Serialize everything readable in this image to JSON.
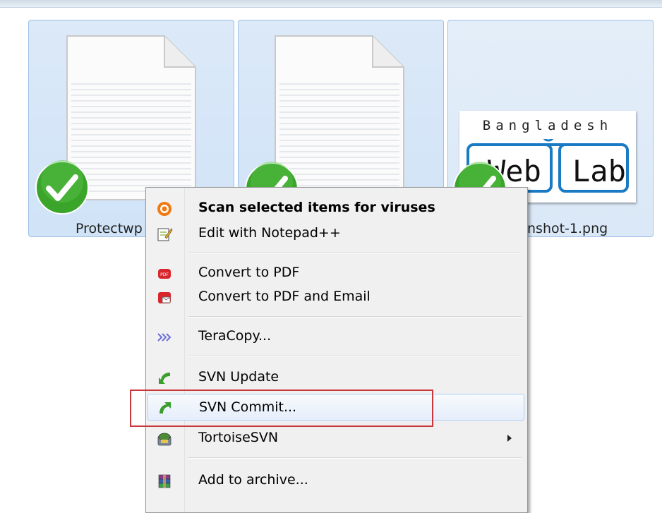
{
  "files": [
    {
      "name": "Protectwp",
      "kind": "text-document"
    },
    {
      "name": "",
      "kind": "text-document"
    },
    {
      "name": "nshot-1.png",
      "kind": "image",
      "thumbnail": {
        "top_text": "Bangladesh",
        "left_text": "Web",
        "right_text": "Lab"
      }
    }
  ],
  "context_menu": {
    "groups": [
      [
        {
          "label": "Scan selected items for viruses",
          "icon": "antivirus-icon",
          "bold": true
        },
        {
          "label": "Edit with Notepad++",
          "icon": "notepad-icon"
        }
      ],
      [
        {
          "label": "Convert to PDF",
          "icon": "pdf-icon"
        },
        {
          "label": "Convert to PDF and Email",
          "icon": "pdf-email-icon"
        }
      ],
      [
        {
          "label": "TeraCopy...",
          "icon": "teracopy-icon"
        }
      ],
      [
        {
          "label": "SVN Update",
          "icon": "svn-update-icon"
        },
        {
          "label": "SVN Commit...",
          "icon": "svn-commit-icon",
          "hovered": true,
          "highlighted": true
        },
        {
          "label": "TortoiseSVN",
          "icon": "tortoisesvn-icon",
          "submenu": true
        }
      ],
      [
        {
          "label": "Add to archive...",
          "icon": "winrar-icon"
        }
      ]
    ]
  },
  "colors": {
    "tile_selected": "#d0e3f7",
    "tile_border": "#9fc1e6",
    "menu_bg": "#f0f0f0",
    "highlight_box": "#c8373b",
    "check_green": "#3aa52a",
    "thumbnail_blue": "#1a7bc4"
  }
}
